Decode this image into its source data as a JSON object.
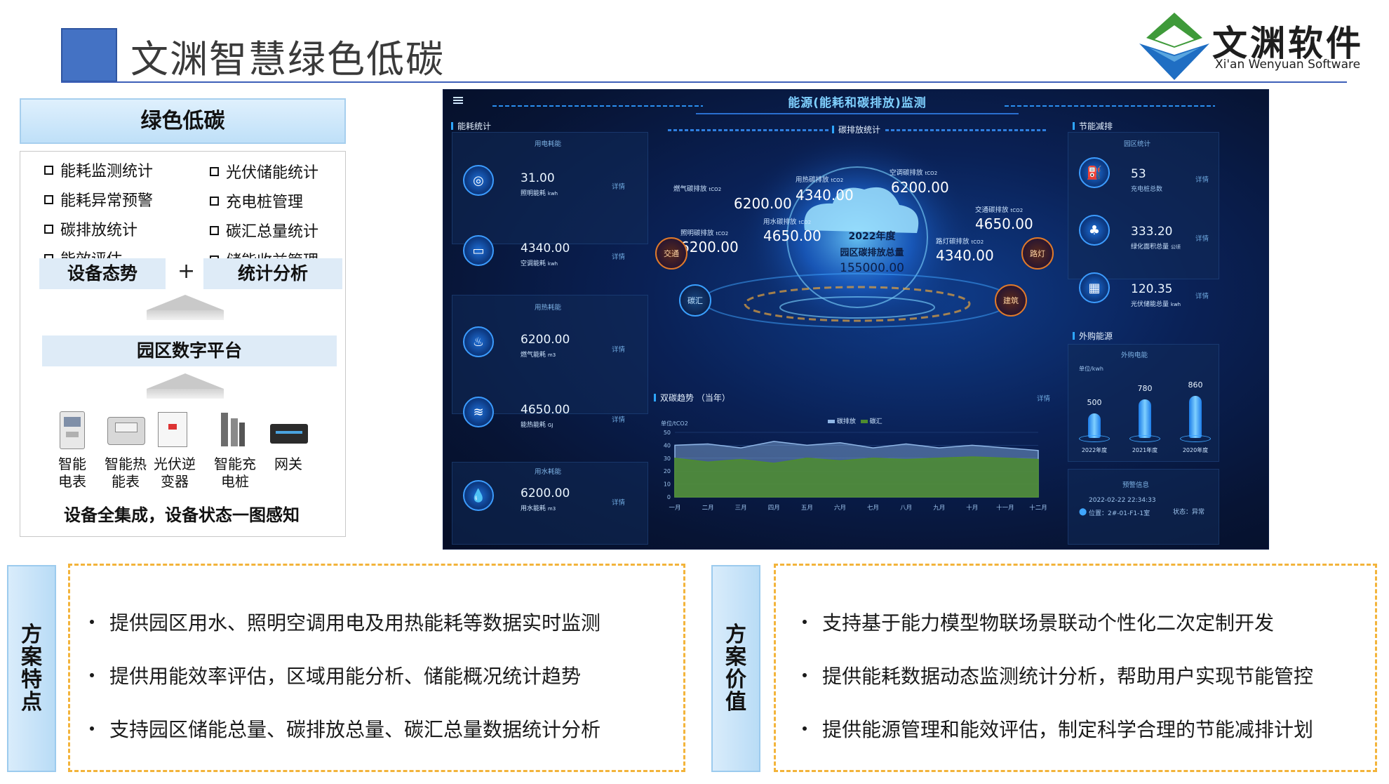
{
  "header": {
    "title": "文渊智慧绿色低碳",
    "logo_cn": "文渊软件",
    "logo_en": "Xi'an Wenyuan Software"
  },
  "left_panel": {
    "title": "绿色低碳",
    "features_left": [
      "能耗监测统计",
      "能耗异常预警",
      "碳排放统计",
      "能效评估"
    ],
    "features_right": [
      "光伏储能统计",
      "充电桩管理",
      "碳汇总量统计",
      "储能收益管理"
    ],
    "tag_left": "设备态势",
    "plus": "+",
    "tag_right": "统计分析",
    "platform": "园区数字平台",
    "devices": [
      {
        "line1": "智能",
        "line2": "电表"
      },
      {
        "line1": "智能热",
        "line2": "能表"
      },
      {
        "line1": "光伏逆",
        "line2": "变器"
      },
      {
        "line1": "智能充",
        "line2": "电桩"
      },
      {
        "line1": "网关",
        "line2": ""
      }
    ],
    "footer": "设备全集成，设备状态一图感知"
  },
  "dashboard": {
    "title": "能源(能耗和碳排放)监测",
    "sec_energy": "能耗统计",
    "sec_carbon": "碳排放统计",
    "sec_saving": "节能减排",
    "sec_trend": "双碳趋势 （当年）",
    "sec_outside": "外购能源",
    "detail": "详情",
    "electric_sub": "用电耗能",
    "heat_sub": "用热耗能",
    "water_sub": "用水耗能",
    "energy_items": [
      {
        "value": "31.00",
        "label": "照明能耗",
        "unit": "kwh"
      },
      {
        "value": "4340.00",
        "label": "空调能耗",
        "unit": "kwh"
      },
      {
        "value": "6200.00",
        "label": "燃气能耗",
        "unit": "m3"
      },
      {
        "value": "4650.00",
        "label": "能热能耗",
        "unit": "GJ"
      },
      {
        "value": "6200.00",
        "label": "用水能耗",
        "unit": "m3"
      }
    ],
    "carbon_items": [
      {
        "label": "燃气碳排放",
        "unit": "tCO2",
        "value": "6200.00"
      },
      {
        "label": "用热碳排放",
        "unit": "tCO2",
        "value": "4340.00"
      },
      {
        "label": "空调碳排放",
        "unit": "tCO2",
        "value": "6200.00"
      },
      {
        "label": "用水碳排放",
        "unit": "tCO2",
        "value": "4650.00"
      },
      {
        "label": "交通碳排放",
        "unit": "tCO2",
        "value": "4650.00"
      },
      {
        "label": "照明碳排放",
        "unit": "tCO2",
        "value": "6200.00"
      },
      {
        "label": "路灯碳排放",
        "unit": "tCO2",
        "value": "4340.00"
      }
    ],
    "center_year": "2022年度",
    "center_label": "园区碳排放总量",
    "center_value": "155000.00",
    "badges": [
      "交通",
      "碳汇",
      "路灯",
      "建筑"
    ],
    "park_sub": "园区统计",
    "park_items": [
      {
        "value": "53",
        "label": "充电桩总数"
      },
      {
        "value": "333.20",
        "label": "绿化面积总量",
        "unit": "公顷"
      },
      {
        "value": "120.35",
        "label": "光伏储能总量",
        "unit": "kwh"
      }
    ],
    "outside_sub": "外购电能",
    "outside_unit": "单位/kwh",
    "warn_sub": "预警信息",
    "warn_time": "2022-02-22 22:34:33",
    "warn_pos": "位置：2#-01-F1-1室",
    "warn_state": "状态：异常",
    "trend_unit": "单位/tCO2",
    "legend_a": "碳排放",
    "legend_b": "碳汇"
  },
  "chart_data": [
    {
      "type": "area",
      "title": "双碳趋势 （当年）",
      "ylabel": "单位/tCO2",
      "categories": [
        "一月",
        "二月",
        "三月",
        "四月",
        "五月",
        "六月",
        "七月",
        "八月",
        "九月",
        "十月",
        "十一月",
        "十二月"
      ],
      "yticks": [
        0,
        10,
        20,
        30,
        40,
        50
      ],
      "ylim": [
        0,
        50
      ],
      "legend": "top-center",
      "series": [
        {
          "name": "碳排放",
          "color": "#8fb6e6",
          "values": [
            40,
            41,
            38,
            43,
            40,
            42,
            38,
            41,
            38,
            40,
            38,
            36
          ]
        },
        {
          "name": "碳汇",
          "color": "#4e8d2f",
          "values": [
            30,
            27,
            29,
            26,
            30,
            28,
            30,
            29,
            30,
            31,
            30,
            29
          ]
        }
      ]
    },
    {
      "type": "bar",
      "title": "外购电能",
      "ylabel": "单位/kwh",
      "categories": [
        "2022年度",
        "2021年度",
        "2020年度"
      ],
      "values": [
        500,
        780,
        860
      ],
      "ylim": [
        0,
        1000
      ]
    }
  ],
  "bottom_left": {
    "tab": "方案特点",
    "bullets": [
      "提供园区用水、照明空调用电及用热能耗等数据实时监测",
      "提供用能效率评估，区域用能分析、储能概况统计趋势",
      "支持园区储能总量、碳排放总量、碳汇总量数据统计分析"
    ]
  },
  "bottom_right": {
    "tab": "方案价值",
    "bullets": [
      "支持基于能力模型物联场景联动个性化二次定制开发",
      "提供能耗数据动态监测统计分析，帮助用户实现节能管控",
      "提供能源管理和能效评估，制定科学合理的节能减排计划"
    ]
  }
}
